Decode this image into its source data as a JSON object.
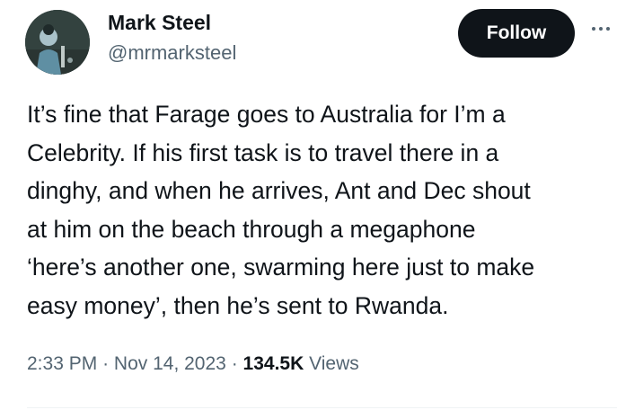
{
  "author": {
    "name": "Mark Steel",
    "handle": "@mrmarksteel"
  },
  "actions": {
    "follow_label": "Follow",
    "more_icon": "more-horizontal-icon"
  },
  "tweet": {
    "lines": [
      "It’s fine that Farage goes to Australia for I’m a",
      "Celebrity. If his first task is to travel there in a",
      "dinghy, and when he arrives, Ant and Dec shout",
      "at him on the beach through a megaphone",
      "‘here’s another one, swarming here just to make",
      "easy money’, then he’s sent to Rwanda."
    ]
  },
  "meta": {
    "time": "2:33 PM",
    "separator": "·",
    "date": "Nov 14, 2023",
    "views_count": "134.5K",
    "views_label": "Views"
  },
  "colors": {
    "text_primary": "#0f1419",
    "text_secondary": "#536471",
    "follow_bg": "#0f1419",
    "follow_text": "#ffffff"
  }
}
